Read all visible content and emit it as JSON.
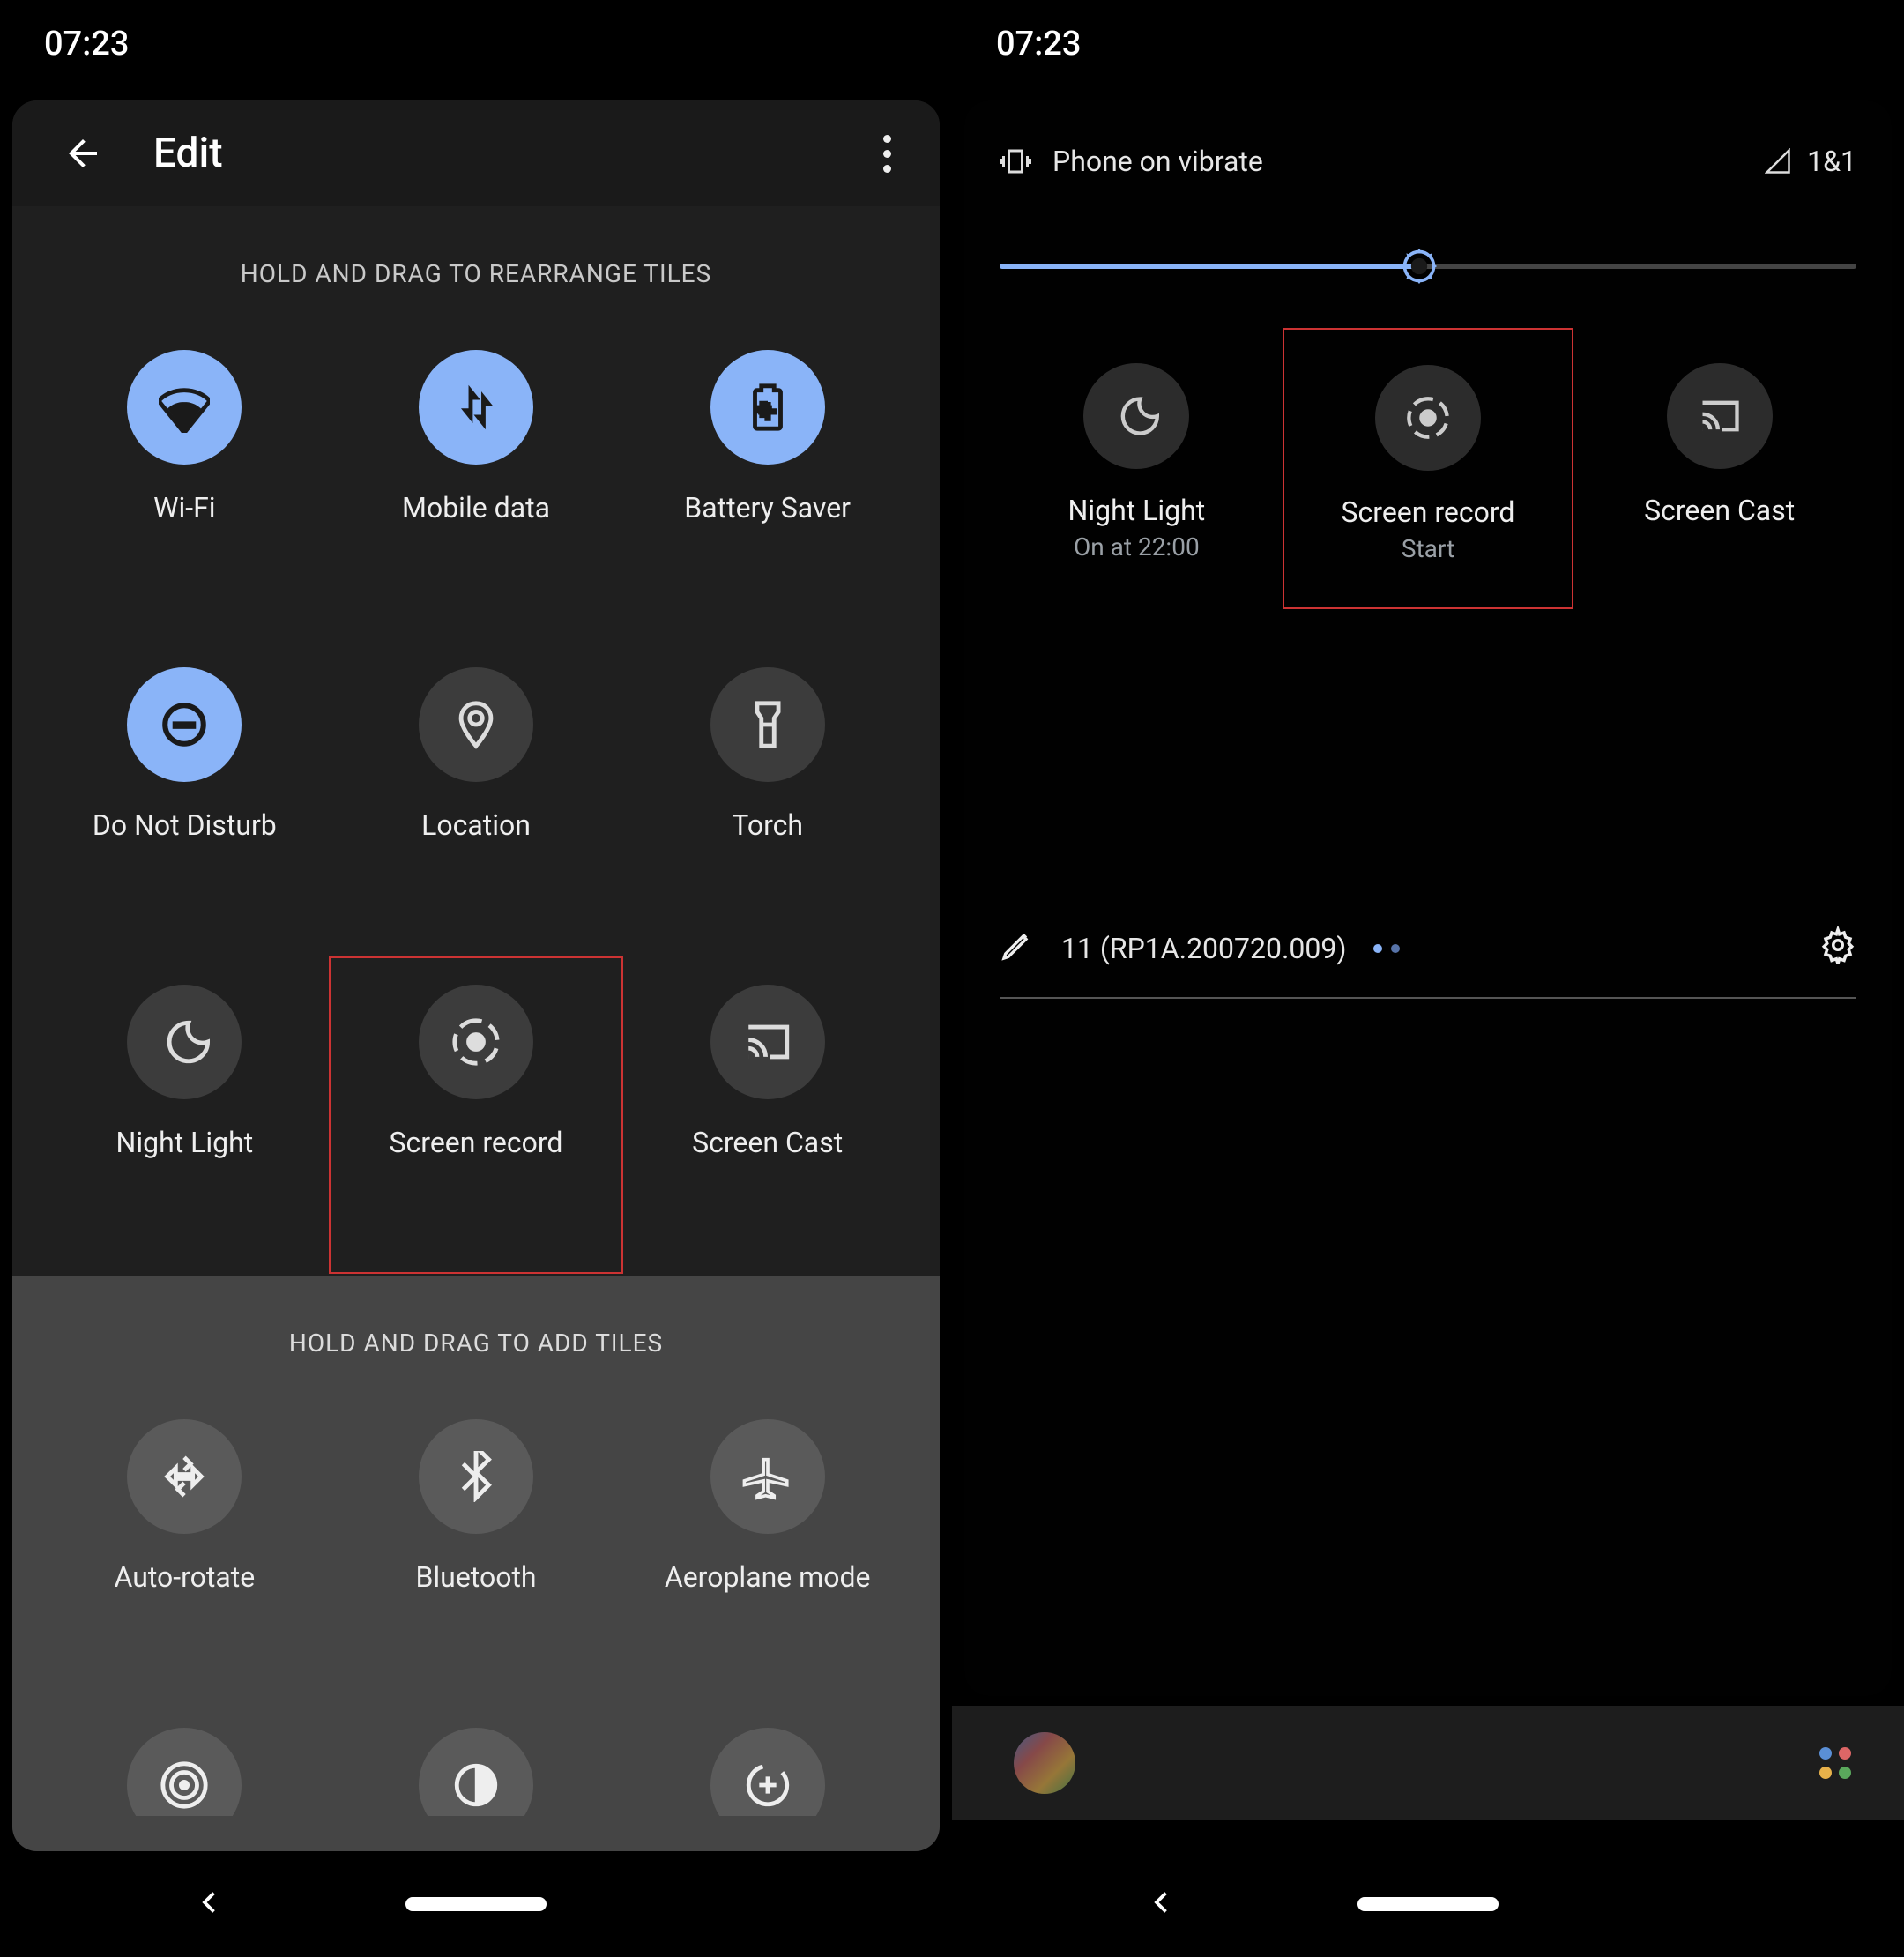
{
  "status": {
    "time": "07:23"
  },
  "left": {
    "title": "Edit",
    "hint_rearrange": "HOLD AND DRAG TO REARRANGE TILES",
    "hint_add": "HOLD AND DRAG TO ADD TILES",
    "tiles_active": [
      {
        "label": "Wi-Fi"
      },
      {
        "label": "Mobile data"
      },
      {
        "label": "Battery Saver"
      },
      {
        "label": "Do Not Disturb"
      },
      {
        "label": "Location"
      },
      {
        "label": "Torch"
      },
      {
        "label": "Night Light"
      },
      {
        "label": "Screen record"
      },
      {
        "label": "Screen Cast"
      }
    ],
    "tiles_available": [
      {
        "label": "Auto-rotate"
      },
      {
        "label": "Bluetooth"
      },
      {
        "label": "Aeroplane mode"
      }
    ]
  },
  "right": {
    "ringer": "Phone on vibrate",
    "carrier": "1&1",
    "brightness_pct": 49,
    "tiles": [
      {
        "label": "Night Light",
        "sub": "On at 22:00"
      },
      {
        "label": "Screen record",
        "sub": "Start"
      },
      {
        "label": "Screen Cast",
        "sub": ""
      }
    ],
    "build": "11 (RP1A.200720.009)"
  }
}
